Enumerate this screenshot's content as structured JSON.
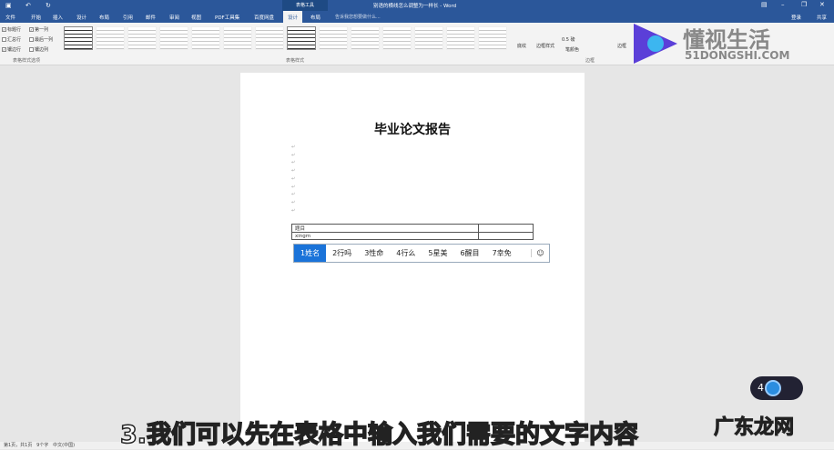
{
  "titlebar": {
    "title": "别语的横线怎么调整为一样长 - Word",
    "context_tab": "表格工具"
  },
  "tabs": [
    "文件",
    "开始",
    "插入",
    "设计",
    "布局",
    "引用",
    "邮件",
    "审阅",
    "视图",
    "PDF工具集",
    "百度网盘",
    "设计",
    "布局"
  ],
  "active_tab_index": 11,
  "search_placeholder": "告诉我您想要做什么...",
  "account": {
    "login": "登录",
    "share": "共享"
  },
  "ribbon": {
    "options": [
      {
        "label": "标题行",
        "checked": true
      },
      {
        "label": "第一列",
        "checked": true
      },
      {
        "label": "汇总行",
        "checked": false
      },
      {
        "label": "最后一列",
        "checked": false
      },
      {
        "label": "镶边行",
        "checked": true
      },
      {
        "label": "镶边列",
        "checked": false
      }
    ],
    "group_options": "表格样式选项",
    "group_styles": "表格样式",
    "shading": "底纹",
    "border_styles": "边框样式",
    "pen_weight": "0.5 磅",
    "pen_color": "笔颜色",
    "borders": "边框",
    "group_borders": "边框"
  },
  "document": {
    "title": "毕业论文报告",
    "table": [
      [
        "题目",
        ""
      ],
      [
        "xingm",
        ""
      ]
    ]
  },
  "ime": {
    "candidates": [
      "1姓名",
      "2行吗",
      "3性命",
      "4行么",
      "5星美",
      "6醒目",
      "7幸免"
    ],
    "selected": 0
  },
  "status": {
    "page": "第1页，共1页",
    "words": "9个字",
    "lang": "中文(中国)"
  },
  "overlay": {
    "subtitle": "3.我们可以先在表格中输入我们需要的文字内容",
    "watermark": "广东龙网",
    "logo_cn": "懂视生活",
    "logo_en": "51DONGSHI.COM",
    "widget_value": "4"
  }
}
